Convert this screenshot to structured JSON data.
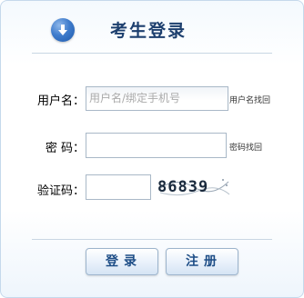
{
  "header": {
    "title": "考生登录",
    "icon": "download-arrow-icon"
  },
  "form": {
    "username": {
      "label": "用户名：",
      "placeholder": "用户名/绑定手机号",
      "recover_link": "用户名找回"
    },
    "password": {
      "label": "密 码：",
      "value": "",
      "recover_link": "密码找回"
    },
    "captcha": {
      "label": "验证码：",
      "value": "",
      "code": "86839"
    }
  },
  "buttons": {
    "login": "登录",
    "register": "注册"
  },
  "colors": {
    "title": "#1d3f6e",
    "button_text": "#1d4d86",
    "border": "#a9b8c7"
  }
}
